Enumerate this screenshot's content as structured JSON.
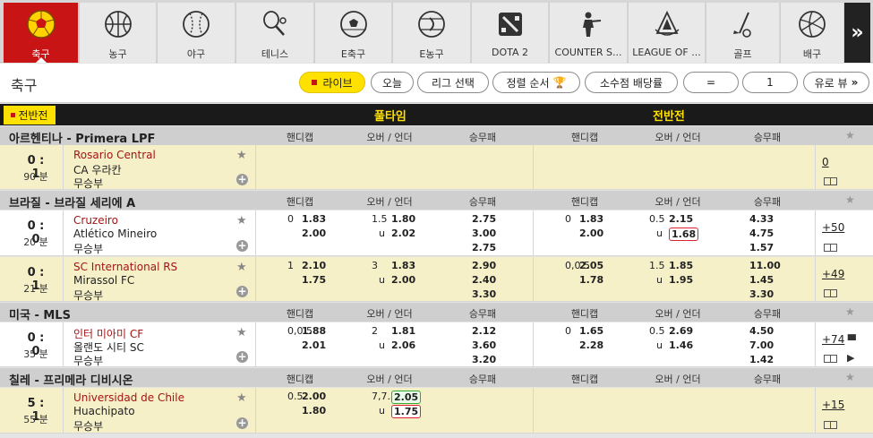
{
  "sports": [
    {
      "label": "축구",
      "icon": "soccer-ball-icon",
      "active": true
    },
    {
      "label": "농구",
      "icon": "basketball-icon"
    },
    {
      "label": "야구",
      "icon": "baseball-icon"
    },
    {
      "label": "테니스",
      "icon": "tennis-icon"
    },
    {
      "label": "E축구",
      "icon": "esoccer-icon"
    },
    {
      "label": "E농구",
      "icon": "ebasketball-icon"
    },
    {
      "label": "DOTA 2",
      "icon": "dota2-icon"
    },
    {
      "label": "COUNTER S...",
      "icon": "counter-strike-icon"
    },
    {
      "label": "LEAGUE OF ...",
      "icon": "league-of-legends-icon"
    },
    {
      "label": "골프",
      "icon": "golf-icon"
    },
    {
      "label": "배구",
      "icon": "volleyball-icon"
    }
  ],
  "nav_next": "»",
  "filters": {
    "title": "축구",
    "live": "라이브",
    "today": "오늘",
    "league_select": "리그 선택",
    "sort": "정렬 순서",
    "decimal": "소수점 배당률",
    "equals": "=",
    "one": "1",
    "euro_view": "유로 뷰"
  },
  "header": {
    "half_tag": "전반전",
    "full_time": "풀타임",
    "first_half": "전반전"
  },
  "col_headers": {
    "handicap": "핸디캡",
    "over_under": "오버 / 언더",
    "result": "승무패"
  },
  "leagues": [
    {
      "name": "아르헨티나 - Primera LPF"
    },
    {
      "name": "브라질 - 브라질 세리에 A"
    },
    {
      "name": "미국 - MLS"
    },
    {
      "name": "칠레 - 프리메라 디비시온"
    }
  ],
  "matches": [
    {
      "score": "0 : 1",
      "minute": "90 분",
      "home": "Rosario Central",
      "away": "CA 우라칸",
      "draw": "무승부",
      "more": "0",
      "ft": {
        "hc_line": "",
        "hc_home": "",
        "hc_away": "",
        "ou_line": "",
        "ou_u": "",
        "ou_over": "",
        "ou_under": "",
        "r1": "",
        "rx": "",
        "r2": ""
      },
      "fh": {
        "hc_line": "",
        "hc_home": "",
        "hc_away": "",
        "ou_line": "",
        "ou_u": "",
        "ou_over": "",
        "ou_under": "",
        "r1": "",
        "rx": "",
        "r2": ""
      }
    },
    {
      "score": "0 : 0",
      "minute": "20 분",
      "home": "Cruzeiro",
      "away": "Atlético Mineiro",
      "draw": "무승부",
      "more": "+50",
      "ft": {
        "hc_line": "0",
        "hc_home": "1.83",
        "hc_away": "2.00",
        "ou_line": "1.5",
        "ou_u": "u",
        "ou_over": "1.80",
        "ou_under": "2.02",
        "r1": "2.75",
        "rx": "3.00",
        "r2": "2.75"
      },
      "fh": {
        "hc_line": "0",
        "hc_home": "1.83",
        "hc_away": "2.00",
        "ou_line": "0.5",
        "ou_u": "u",
        "ou_over": "2.15",
        "ou_under": "1.68",
        "r1": "4.33",
        "rx": "4.75",
        "r2": "1.57"
      }
    },
    {
      "score": "0 : 1",
      "minute": "21 분",
      "home": "SC International RS",
      "away": "Mirassol FC",
      "draw": "무승부",
      "more": "+49",
      "ft": {
        "hc_line": "1",
        "hc_home": "2.10",
        "hc_away": "1.75",
        "ou_line": "3",
        "ou_u": "u",
        "ou_over": "1.83",
        "ou_under": "2.00",
        "r1": "2.90",
        "rx": "2.40",
        "r2": "3.30"
      },
      "fh": {
        "hc_line": "0,0.5",
        "hc_home": "2.05",
        "hc_away": "1.78",
        "ou_line": "1.5",
        "ou_u": "u",
        "ou_over": "1.85",
        "ou_under": "1.95",
        "r1": "11.00",
        "rx": "1.45",
        "r2": "3.30"
      }
    },
    {
      "score": "0 : 0",
      "minute": "35 분",
      "home": "인터 미아미 CF",
      "away": "올랜도 시티 SC",
      "draw": "무승부",
      "more": "+74",
      "ft": {
        "hc_line": "0,0.5",
        "hc_home": "1.88",
        "hc_away": "2.01",
        "ou_line": "2",
        "ou_u": "u",
        "ou_over": "1.81",
        "ou_under": "2.06",
        "r1": "2.12",
        "rx": "3.60",
        "r2": "3.20"
      },
      "fh": {
        "hc_line": "0",
        "hc_home": "1.65",
        "hc_away": "2.28",
        "ou_line": "0.5",
        "ou_u": "u",
        "ou_over": "2.69",
        "ou_under": "1.46",
        "r1": "4.50",
        "rx": "7.00",
        "r2": "1.42"
      }
    },
    {
      "score": "5 : 1",
      "minute": "55 분",
      "home": "Universidad de Chile",
      "away": "Huachipato",
      "draw": "무승부",
      "more": "+15",
      "ft": {
        "hc_line": "0.5",
        "hc_home": "2.00",
        "hc_away": "1.80",
        "ou_line": "7,7.5",
        "ou_u": "u",
        "ou_over": "2.05",
        "ou_under": "1.75",
        "r1": "",
        "rx": "",
        "r2": ""
      },
      "fh": {
        "hc_line": "",
        "hc_home": "",
        "hc_away": "",
        "ou_line": "",
        "ou_u": "",
        "ou_over": "",
        "ou_under": "",
        "r1": "",
        "rx": "",
        "r2": ""
      }
    }
  ]
}
